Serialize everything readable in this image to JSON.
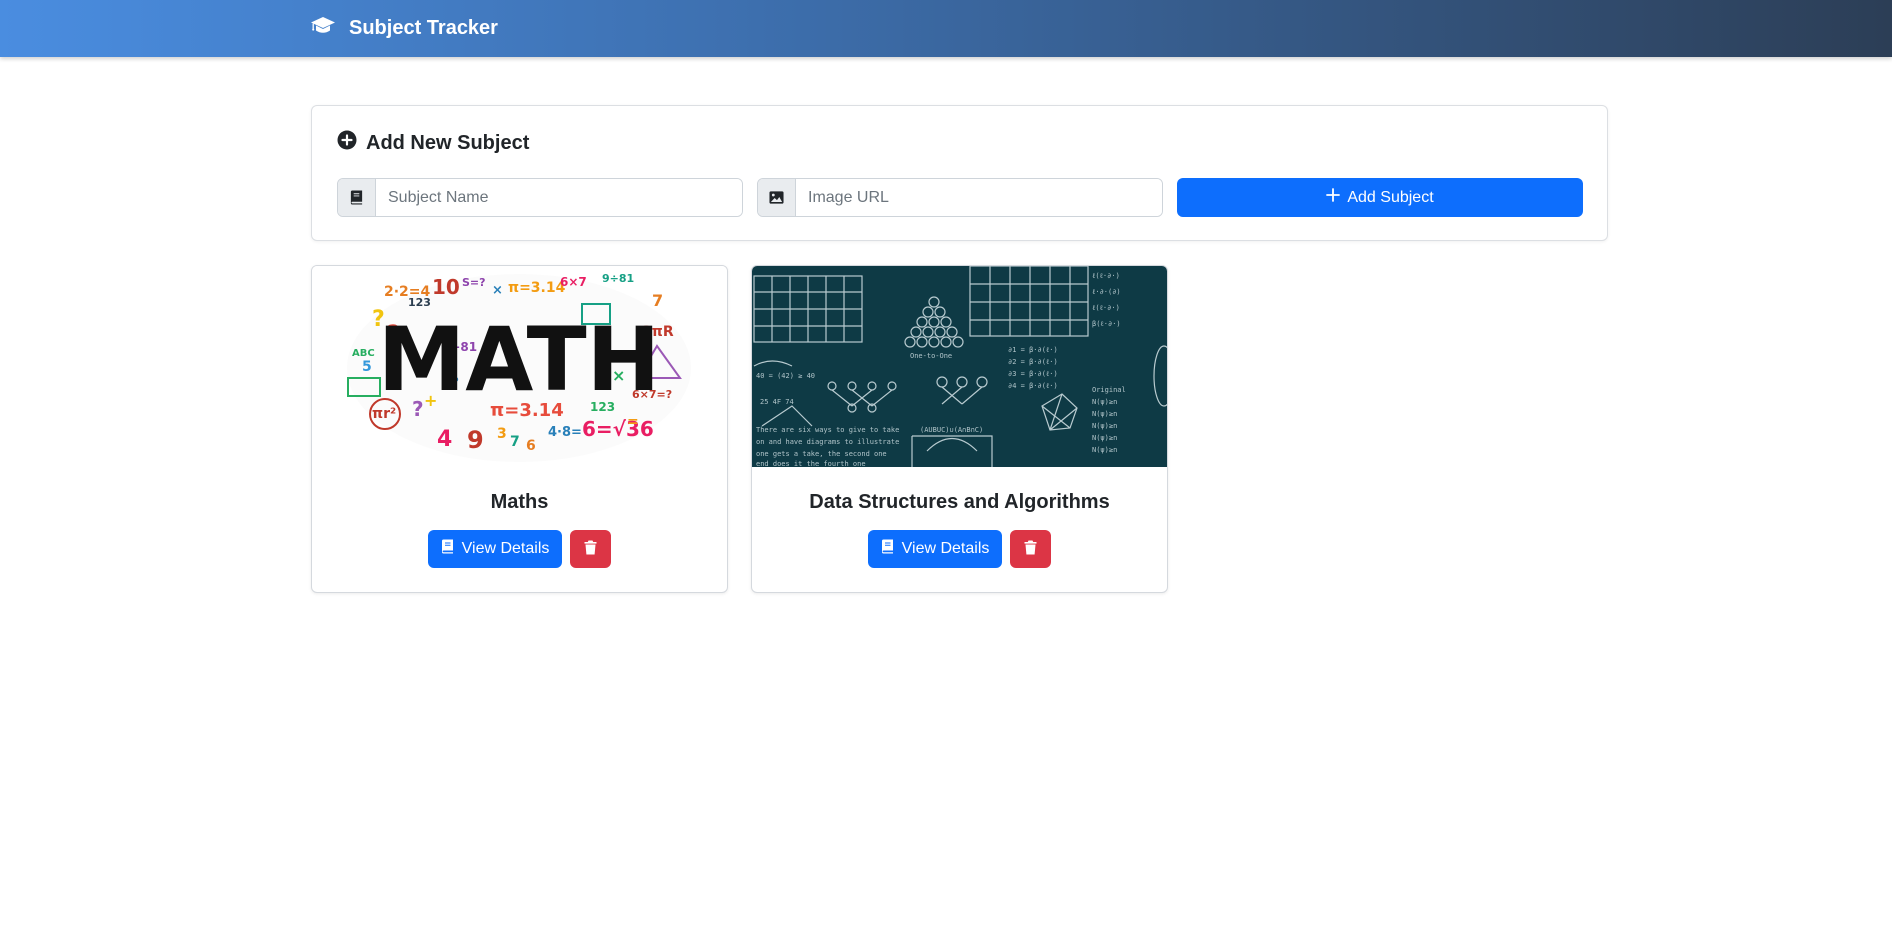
{
  "app": {
    "title": "Subject Tracker",
    "brand_icon": "graduation-cap-icon"
  },
  "form": {
    "title": "Add New Subject",
    "title_icon": "plus-circle-icon",
    "subject_name": {
      "value": "",
      "placeholder": "Subject Name",
      "icon": "book-icon"
    },
    "image_url": {
      "value": "",
      "placeholder": "Image URL",
      "icon": "image-icon"
    },
    "submit_label": "Add Subject"
  },
  "subjects": [
    {
      "name": "Maths",
      "view_label": "View Details",
      "image": "math-illustration",
      "image_text": "MATH"
    },
    {
      "name": "Data Structures and Algorithms",
      "view_label": "View Details",
      "image": "chalkboard-diagrams"
    }
  ],
  "colors": {
    "primary": "#0d6efd",
    "danger": "#dc3545",
    "navbar_start": "#4a8de0",
    "navbar_end": "#2c3e56",
    "chalkboard": "#0e3a45"
  }
}
